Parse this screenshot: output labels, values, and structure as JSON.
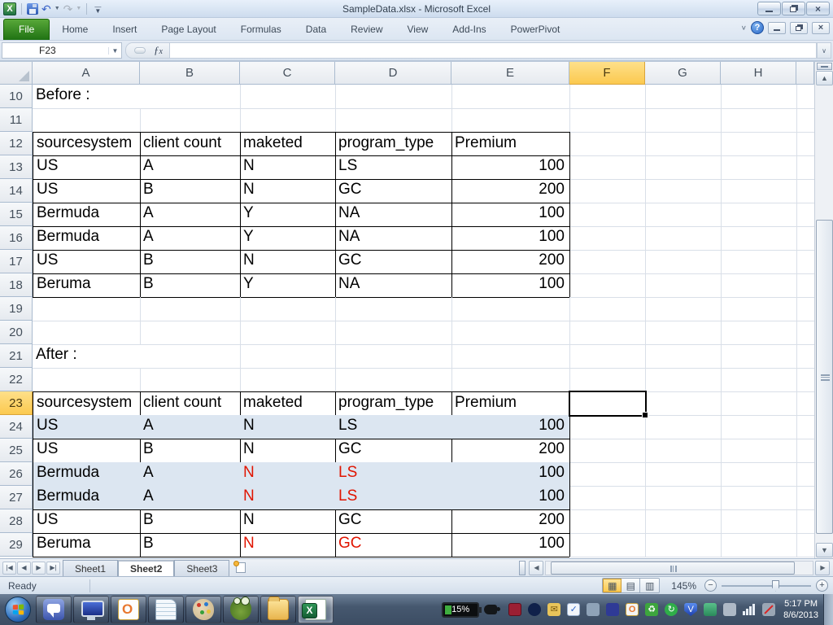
{
  "window": {
    "title": "SampleData.xlsx  -  Microsoft Excel"
  },
  "colors": {
    "file_tab_green": "#2c7519",
    "selected_header_amber": "#fbc94f",
    "table_fill_blue": "#dce6f1",
    "red_text": "#e01400",
    "taskbar_bg": "#46586f"
  },
  "ribbon": {
    "tabs": [
      "File",
      "Home",
      "Insert",
      "Page Layout",
      "Formulas",
      "Data",
      "Review",
      "View",
      "Add-Ins",
      "PowerPivot"
    ]
  },
  "formula_bar": {
    "name_box": "F23",
    "fx_label": "fx",
    "formula_value": ""
  },
  "grid": {
    "columns": [
      "A",
      "B",
      "C",
      "D",
      "E",
      "F",
      "G",
      "H",
      ""
    ],
    "selected_cell": {
      "col": "F",
      "row": 23
    },
    "rows": [
      {
        "n": 10,
        "cells": [
          {
            "c": "A",
            "v": "Before :"
          }
        ]
      },
      {
        "n": 11
      },
      {
        "n": 12,
        "table": true,
        "cells": [
          {
            "c": "A",
            "v": "sourcesystem"
          },
          {
            "c": "B",
            "v": "client count"
          },
          {
            "c": "C",
            "v": "maketed"
          },
          {
            "c": "D",
            "v": "program_type"
          },
          {
            "c": "E",
            "v": "Premium"
          }
        ]
      },
      {
        "n": 13,
        "table": true,
        "cells": [
          {
            "c": "A",
            "v": "US"
          },
          {
            "c": "B",
            "v": "A"
          },
          {
            "c": "C",
            "v": "N"
          },
          {
            "c": "D",
            "v": "LS"
          },
          {
            "c": "E",
            "v": "100",
            "num": true
          }
        ]
      },
      {
        "n": 14,
        "table": true,
        "cells": [
          {
            "c": "A",
            "v": "US"
          },
          {
            "c": "B",
            "v": "B"
          },
          {
            "c": "C",
            "v": "N"
          },
          {
            "c": "D",
            "v": "GC"
          },
          {
            "c": "E",
            "v": "200",
            "num": true
          }
        ]
      },
      {
        "n": 15,
        "table": true,
        "cells": [
          {
            "c": "A",
            "v": "Bermuda"
          },
          {
            "c": "B",
            "v": "A"
          },
          {
            "c": "C",
            "v": "Y"
          },
          {
            "c": "D",
            "v": "NA"
          },
          {
            "c": "E",
            "v": "100",
            "num": true
          }
        ]
      },
      {
        "n": 16,
        "table": true,
        "cells": [
          {
            "c": "A",
            "v": "Bermuda"
          },
          {
            "c": "B",
            "v": "A"
          },
          {
            "c": "C",
            "v": "Y"
          },
          {
            "c": "D",
            "v": "NA"
          },
          {
            "c": "E",
            "v": "100",
            "num": true
          }
        ]
      },
      {
        "n": 17,
        "table": true,
        "cells": [
          {
            "c": "A",
            "v": "US"
          },
          {
            "c": "B",
            "v": "B"
          },
          {
            "c": "C",
            "v": "N"
          },
          {
            "c": "D",
            "v": "GC"
          },
          {
            "c": "E",
            "v": "200",
            "num": true
          }
        ]
      },
      {
        "n": 18,
        "table": true,
        "cells": [
          {
            "c": "A",
            "v": "Beruma"
          },
          {
            "c": "B",
            "v": "B"
          },
          {
            "c": "C",
            "v": "Y"
          },
          {
            "c": "D",
            "v": "NA"
          },
          {
            "c": "E",
            "v": "100",
            "num": true
          }
        ]
      },
      {
        "n": 19
      },
      {
        "n": 20
      },
      {
        "n": 21,
        "cells": [
          {
            "c": "A",
            "v": "After :"
          }
        ]
      },
      {
        "n": 22
      },
      {
        "n": 23,
        "table": true,
        "active": true,
        "cells": [
          {
            "c": "A",
            "v": "sourcesystem"
          },
          {
            "c": "B",
            "v": "client count"
          },
          {
            "c": "C",
            "v": "maketed"
          },
          {
            "c": "D",
            "v": "program_type"
          },
          {
            "c": "E",
            "v": "Premium"
          }
        ]
      },
      {
        "n": 24,
        "table": true,
        "fill": true,
        "cells": [
          {
            "c": "A",
            "v": "US"
          },
          {
            "c": "B",
            "v": "A"
          },
          {
            "c": "C",
            "v": "N"
          },
          {
            "c": "D",
            "v": "LS"
          },
          {
            "c": "E",
            "v": "100",
            "num": true
          }
        ]
      },
      {
        "n": 25,
        "table": true,
        "cells": [
          {
            "c": "A",
            "v": "US"
          },
          {
            "c": "B",
            "v": "B"
          },
          {
            "c": "C",
            "v": "N"
          },
          {
            "c": "D",
            "v": "GC"
          },
          {
            "c": "E",
            "v": "200",
            "num": true
          }
        ]
      },
      {
        "n": 26,
        "table": true,
        "fill": true,
        "cells": [
          {
            "c": "A",
            "v": "Bermuda"
          },
          {
            "c": "B",
            "v": "A"
          },
          {
            "c": "C",
            "v": "N",
            "red": true
          },
          {
            "c": "D",
            "v": "LS",
            "red": true
          },
          {
            "c": "E",
            "v": "100",
            "num": true
          }
        ]
      },
      {
        "n": 27,
        "table": true,
        "fill": true,
        "cells": [
          {
            "c": "A",
            "v": "Bermuda"
          },
          {
            "c": "B",
            "v": "A"
          },
          {
            "c": "C",
            "v": "N",
            "red": true
          },
          {
            "c": "D",
            "v": "LS",
            "red": true
          },
          {
            "c": "E",
            "v": "100",
            "num": true
          }
        ]
      },
      {
        "n": 28,
        "table": true,
        "cells": [
          {
            "c": "A",
            "v": "US"
          },
          {
            "c": "B",
            "v": "B"
          },
          {
            "c": "C",
            "v": "N"
          },
          {
            "c": "D",
            "v": "GC"
          },
          {
            "c": "E",
            "v": "200",
            "num": true
          }
        ]
      },
      {
        "n": 29,
        "table": true,
        "cells": [
          {
            "c": "A",
            "v": "Beruma"
          },
          {
            "c": "B",
            "v": "B"
          },
          {
            "c": "C",
            "v": "N",
            "red": true
          },
          {
            "c": "D",
            "v": "GC",
            "red": true
          },
          {
            "c": "E",
            "v": "100",
            "num": true
          }
        ]
      }
    ]
  },
  "sheet_bar": {
    "tabs": [
      {
        "label": "Sheet1",
        "active": false
      },
      {
        "label": "Sheet2",
        "active": true
      },
      {
        "label": "Sheet3",
        "active": false
      }
    ]
  },
  "status_bar": {
    "mode": "Ready",
    "zoom": "145%"
  },
  "taskbar": {
    "battery": "15%",
    "clock": {
      "time": "5:17 PM",
      "date": "8/6/2013"
    },
    "buttons": [
      {
        "name": "taskbar-lync-button",
        "cls": "ic-lync"
      },
      {
        "name": "taskbar-remote-desktop-button",
        "cls": "ic-rdp"
      },
      {
        "name": "taskbar-outlook-button",
        "cls": "ic-outlook"
      },
      {
        "name": "taskbar-notepad-button",
        "cls": "ic-notepad"
      },
      {
        "name": "taskbar-paint-button",
        "cls": "ic-paint"
      },
      {
        "name": "taskbar-frog-app-button",
        "cls": "ic-frog"
      },
      {
        "name": "taskbar-explorer-button",
        "cls": "ic-folder"
      },
      {
        "name": "taskbar-excel-button",
        "cls": "ic-excel",
        "active": true
      }
    ],
    "tray": [
      {
        "name": "lock-tray-icon",
        "cls": "t-maroon",
        "g": ""
      },
      {
        "name": "disk-tray-icon",
        "cls": "t-disk",
        "g": ""
      },
      {
        "name": "mail-tray-icon",
        "cls": "t-mail",
        "g": "✉"
      },
      {
        "name": "task-check-tray-icon",
        "cls": "t-check",
        "g": "✓"
      },
      {
        "name": "remote-lock-tray-icon",
        "cls": "t-rlock",
        "g": ""
      },
      {
        "name": "app-dots-tray-icon",
        "cls": "t-dots",
        "g": ""
      },
      {
        "name": "outlook-tray-icon",
        "cls": "t-o",
        "g": "O"
      },
      {
        "name": "recycle-warning-tray-icon",
        "cls": "t-recy",
        "g": "♻"
      },
      {
        "name": "sync-tray-icon",
        "cls": "t-sync",
        "g": "↻"
      },
      {
        "name": "antivirus-shield-tray-icon",
        "cls": "t-shield",
        "g": "V"
      },
      {
        "name": "display-tray-icon",
        "cls": "t-disp",
        "g": ""
      },
      {
        "name": "clipboard-tray-icon",
        "cls": "t-clip",
        "g": ""
      },
      {
        "name": "network-signal-tray-icon",
        "cls": "t-signal",
        "g": ""
      },
      {
        "name": "volume-muted-tray-icon",
        "cls": "t-mute",
        "g": ""
      }
    ]
  }
}
